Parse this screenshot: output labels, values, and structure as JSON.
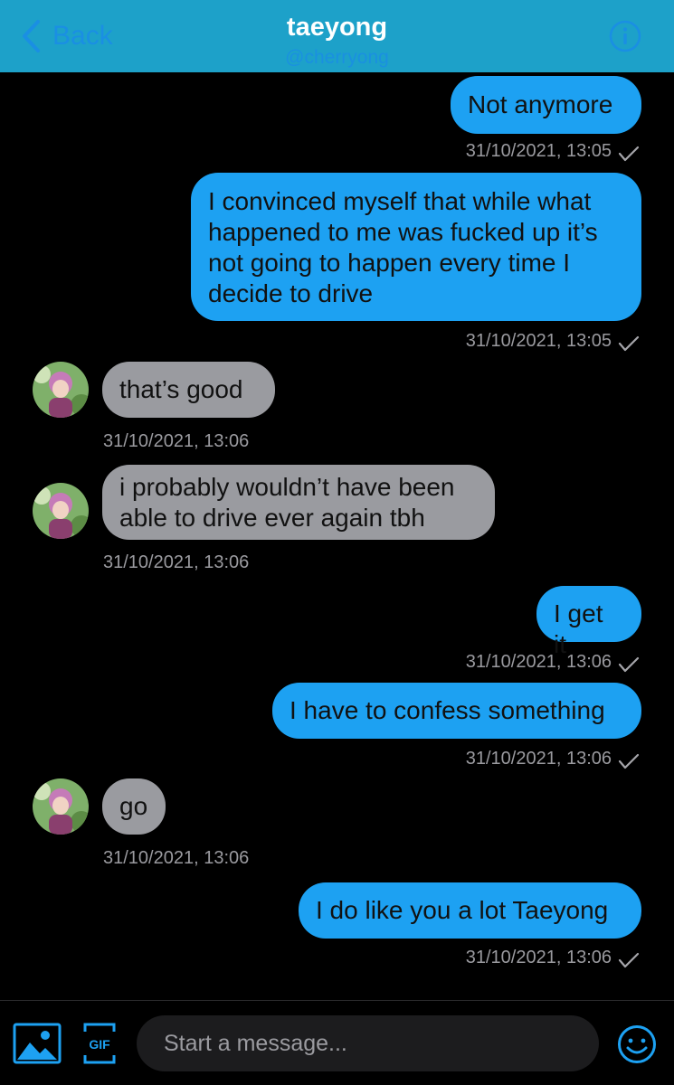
{
  "header": {
    "back_label": "Back",
    "title": "taeyong",
    "handle": "@cherryong",
    "info_icon": "info-icon"
  },
  "messages": [
    {
      "direction": "out",
      "text": "Not anymore",
      "timestamp": "31/10/2021, 13:05"
    },
    {
      "direction": "out",
      "text": "I convinced myself that while what happened to me was fucked up it’s not going to happen every time I decide to drive",
      "timestamp": "31/10/2021, 13:05"
    },
    {
      "direction": "in",
      "text": "that’s good",
      "timestamp": "31/10/2021, 13:06"
    },
    {
      "direction": "in",
      "text": "i probably wouldn’t have been able to drive ever again tbh",
      "timestamp": "31/10/2021, 13:06"
    },
    {
      "direction": "out",
      "text": "I get it",
      "timestamp": "31/10/2021, 13:06"
    },
    {
      "direction": "out",
      "text": "I have to confess something",
      "timestamp": "31/10/2021, 13:06"
    },
    {
      "direction": "in",
      "text": "go",
      "timestamp": "31/10/2021, 13:06"
    },
    {
      "direction": "out",
      "text": "I do like you a lot Taeyong",
      "timestamp": "31/10/2021, 13:06"
    }
  ],
  "composer": {
    "placeholder": "Start a message...",
    "gif_label": "GIF"
  },
  "colors": {
    "header_bg": "#1da1c9",
    "outgoing_bubble": "#1da1f2",
    "incoming_bubble": "#9a9ba0",
    "accent_blue": "#1a8fe3"
  }
}
